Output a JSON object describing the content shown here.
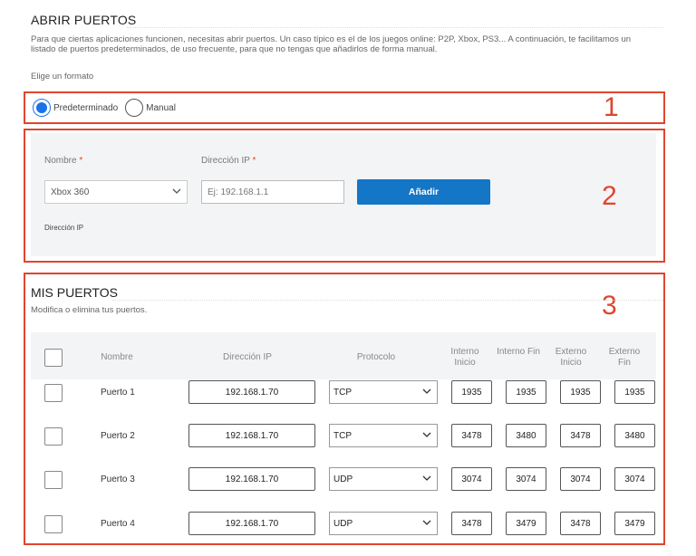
{
  "header": {
    "title": "ABRIR PUERTOS",
    "intro": "Para que ciertas aplicaciones funcionen, necesitas abrir puertos. Un caso típico es el de los juegos online: P2P, Xbox, PS3... A continuación, te facilitamos un listado de puertos predeterminados, de uso frecuente, para que no tengas que añadirlos de forma manual.",
    "format_label": "Elige un formato"
  },
  "annotations": [
    "1",
    "2",
    "3"
  ],
  "format": {
    "options": [
      {
        "label": "Predeterminado",
        "selected": true
      },
      {
        "label": "Manual",
        "selected": false
      }
    ]
  },
  "form": {
    "name_label": "Nombre",
    "ip_label": "Dirección IP",
    "required_mark": "*",
    "name_value": "Xbox 360",
    "ip_placeholder": "Ej: 192.168.1.1",
    "add_button": "Añadir",
    "ip_hint": "Dirección IP"
  },
  "ports": {
    "title": "MIS PUERTOS",
    "description": "Modifica o elimina tus puertos.",
    "columns": {
      "name": "Nombre",
      "ip": "Dirección IP",
      "protocol": "Protocolo",
      "int_start": "Interno Inicio",
      "int_end": "Interno Fin",
      "ext_start": "Externo Inicio",
      "ext_end": "Externo Fin"
    },
    "rows": [
      {
        "name": "Puerto 1",
        "ip": "192.168.1.70",
        "protocol": "TCP",
        "int_start": "1935",
        "int_end": "1935",
        "ext_start": "1935",
        "ext_end": "1935"
      },
      {
        "name": "Puerto 2",
        "ip": "192.168.1.70",
        "protocol": "TCP",
        "int_start": "3478",
        "int_end": "3480",
        "ext_start": "3478",
        "ext_end": "3480"
      },
      {
        "name": "Puerto 3",
        "ip": "192.168.1.70",
        "protocol": "UDP",
        "int_start": "3074",
        "int_end": "3074",
        "ext_start": "3074",
        "ext_end": "3074"
      },
      {
        "name": "Puerto 4",
        "ip": "192.168.1.70",
        "protocol": "UDP",
        "int_start": "3478",
        "int_end": "3479",
        "ext_start": "3478",
        "ext_end": "3479"
      }
    ]
  },
  "colors": {
    "accent": "#1a73e8",
    "button": "#1476c6",
    "annotation": "#e0452d"
  }
}
